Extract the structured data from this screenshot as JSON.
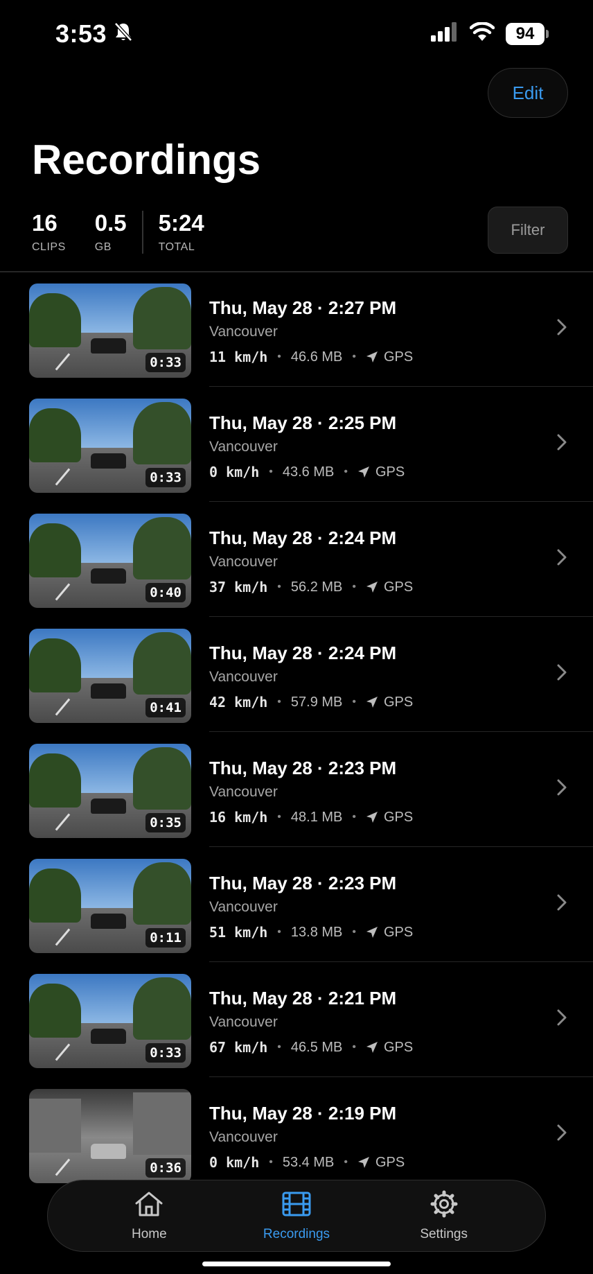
{
  "status_bar": {
    "time": "3:53",
    "battery": "94",
    "icons": [
      "bell-slash-icon",
      "signal-icon",
      "wifi-icon",
      "battery-icon"
    ]
  },
  "header": {
    "edit_label": "Edit",
    "title": "Recordings"
  },
  "stats": {
    "clips_value": "16",
    "clips_label": "CLIPS",
    "storage_value": "0.5",
    "storage_label": "GB",
    "total_value": "5:24",
    "total_label": "TOTAL",
    "filter_label": "Filter"
  },
  "recordings": [
    {
      "title": "Thu, May 28 · 2:27 PM",
      "location": "Vancouver",
      "speed": "11 km/h",
      "size": "46.6 MB",
      "gps": "GPS",
      "duration": "0:33",
      "scene": "street"
    },
    {
      "title": "Thu, May 28 · 2:25 PM",
      "location": "Vancouver",
      "speed": "0 km/h",
      "size": "43.6 MB",
      "gps": "GPS",
      "duration": "0:33",
      "scene": "street"
    },
    {
      "title": "Thu, May 28 · 2:24 PM",
      "location": "Vancouver",
      "speed": "37 km/h",
      "size": "56.2 MB",
      "gps": "GPS",
      "duration": "0:40",
      "scene": "highway"
    },
    {
      "title": "Thu, May 28 · 2:24 PM",
      "location": "Vancouver",
      "speed": "42 km/h",
      "size": "57.9 MB",
      "gps": "GPS",
      "duration": "0:41",
      "scene": "street"
    },
    {
      "title": "Thu, May 28 · 2:23 PM",
      "location": "Vancouver",
      "speed": "16 km/h",
      "size": "48.1 MB",
      "gps": "GPS",
      "duration": "0:35",
      "scene": "street"
    },
    {
      "title": "Thu, May 28 · 2:23 PM",
      "location": "Vancouver",
      "speed": "51 km/h",
      "size": "13.8 MB",
      "gps": "GPS",
      "duration": "0:11",
      "scene": "highway"
    },
    {
      "title": "Thu, May 28 · 2:21 PM",
      "location": "Vancouver",
      "speed": "67 km/h",
      "size": "46.5 MB",
      "gps": "GPS",
      "duration": "0:33",
      "scene": "street"
    },
    {
      "title": "Thu, May 28 · 2:19 PM",
      "location": "Vancouver",
      "speed": "0 km/h",
      "size": "53.4 MB",
      "gps": "GPS",
      "duration": "0:36",
      "scene": "tunnel"
    }
  ],
  "tab_bar": {
    "tabs": [
      {
        "label": "Home",
        "icon": "house-icon",
        "active": false
      },
      {
        "label": "Recordings",
        "icon": "film-icon",
        "active": true
      },
      {
        "label": "Settings",
        "icon": "gear-icon",
        "active": false
      }
    ]
  },
  "colors": {
    "accent": "#3a9bf0",
    "background": "#000000"
  }
}
